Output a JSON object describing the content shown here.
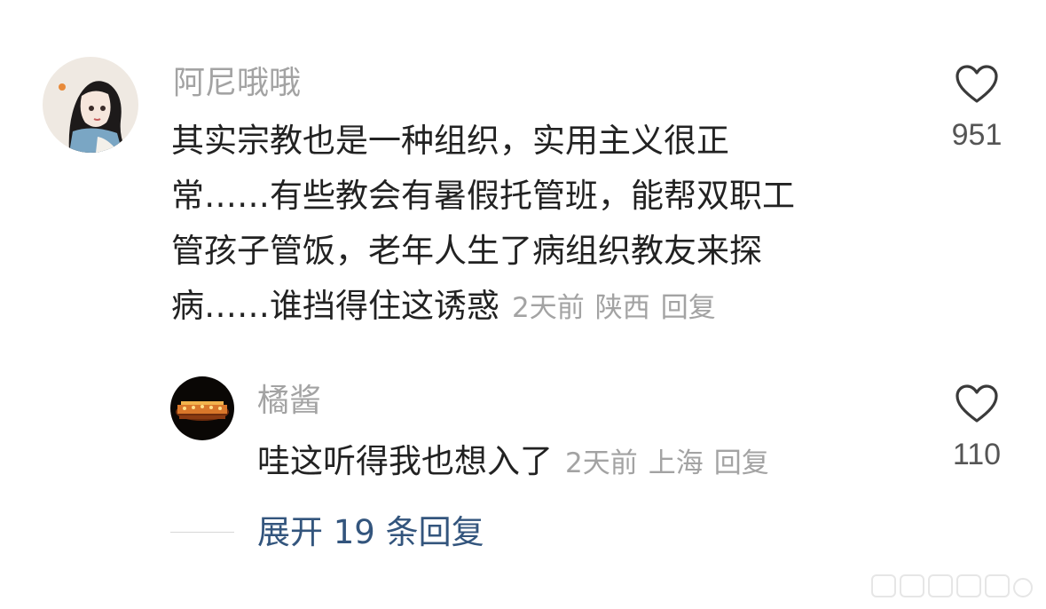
{
  "comments": [
    {
      "username": "阿尼哦哦",
      "text_lines": [
        "其实宗教也是一种组织，实用主义很正",
        "常……有些教会有暑假托管班，能帮双职工",
        "管孩子管饭，老年人生了病组织教友来探",
        "病……谁挡得住这诱惑"
      ],
      "time": "2天前",
      "location": "陕西",
      "reply_label": "回复",
      "like_count": "951",
      "like_icon": "heart-outline-icon"
    },
    {
      "username": "橘酱",
      "text_lines": [
        "哇这听得我也想入了"
      ],
      "time": "2天前",
      "location": "上海",
      "reply_label": "回复",
      "like_count": "110",
      "like_icon": "heart-outline-icon"
    }
  ],
  "expand_replies_label": "展开 19 条回复",
  "colors": {
    "username": "#a3a3a3",
    "text": "#222222",
    "meta": "#a3a3a3",
    "expand_link": "#33557d",
    "like_count": "#555555"
  }
}
